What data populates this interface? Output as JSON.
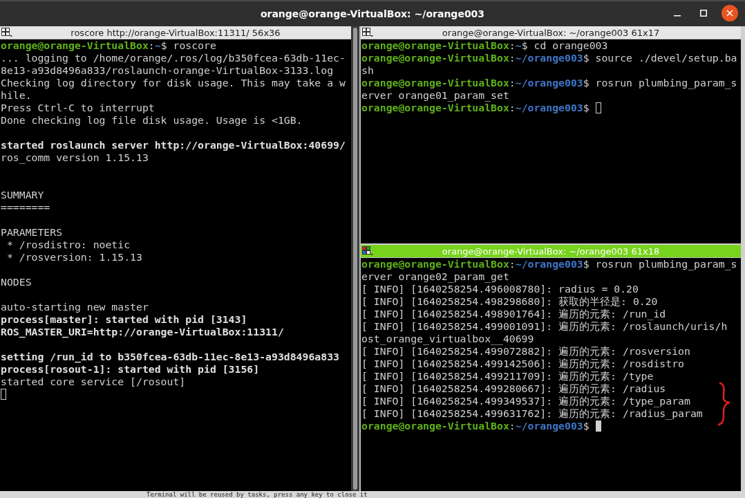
{
  "window": {
    "title": "orange@orange-VirtualBox: ~/orange003"
  },
  "left_pane": {
    "title": "roscore http://orange-VirtualBox:11311/ 56x36",
    "focused": false,
    "lines": [
      [
        {
          "kind": "user",
          "text": "orange@orange-VirtualBox"
        },
        {
          "kind": "plain",
          "text": ":"
        },
        {
          "kind": "path",
          "text": "~"
        },
        {
          "kind": "plain",
          "text": "$ roscore"
        }
      ],
      [
        {
          "kind": "plain",
          "text": "... logging to /home/orange/.ros/log/b350fcea-63db-11ec-"
        }
      ],
      [
        {
          "kind": "plain",
          "text": "8e13-a93d8496a833/roslaunch-orange-VirtualBox-3133.log"
        }
      ],
      [
        {
          "kind": "plain",
          "text": "Checking log directory for disk usage. This may take a w"
        }
      ],
      [
        {
          "kind": "plain",
          "text": "hile."
        }
      ],
      [
        {
          "kind": "plain",
          "text": "Press Ctrl-C to interrupt"
        }
      ],
      [
        {
          "kind": "plain",
          "text": "Done checking log file disk usage. Usage is <1GB."
        }
      ],
      [
        {
          "kind": "blank"
        }
      ],
      [
        {
          "kind": "bold",
          "text": "started roslaunch server http://orange-VirtualBox:40699/"
        }
      ],
      [
        {
          "kind": "plain",
          "text": "ros_comm version 1.15.13"
        }
      ],
      [
        {
          "kind": "blank"
        }
      ],
      [
        {
          "kind": "blank"
        }
      ],
      [
        {
          "kind": "plain",
          "text": "SUMMARY"
        }
      ],
      [
        {
          "kind": "plain",
          "text": "========"
        }
      ],
      [
        {
          "kind": "blank"
        }
      ],
      [
        {
          "kind": "plain",
          "text": "PARAMETERS"
        }
      ],
      [
        {
          "kind": "plain",
          "text": " * /rosdistro: noetic"
        }
      ],
      [
        {
          "kind": "plain",
          "text": " * /rosversion: 1.15.13"
        }
      ],
      [
        {
          "kind": "blank"
        }
      ],
      [
        {
          "kind": "plain",
          "text": "NODES"
        }
      ],
      [
        {
          "kind": "blank"
        }
      ],
      [
        {
          "kind": "plain",
          "text": "auto-starting new master"
        }
      ],
      [
        {
          "kind": "bold",
          "text": "process[master]: started with pid [3143]"
        }
      ],
      [
        {
          "kind": "bold",
          "text": "ROS_MASTER_URI=http://orange-VirtualBox:11311/"
        }
      ],
      [
        {
          "kind": "blank"
        }
      ],
      [
        {
          "kind": "bold",
          "text": "setting /run_id to b350fcea-63db-11ec-8e13-a93d8496a833"
        }
      ],
      [
        {
          "kind": "bold",
          "text": "process[rosout-1]: started with pid [3156]"
        }
      ],
      [
        {
          "kind": "plain",
          "text": "started core service [/rosout]"
        }
      ],
      [
        {
          "kind": "cursor"
        }
      ]
    ]
  },
  "right_panes": [
    {
      "title": "orange@orange-VirtualBox: ~/orange003 61x17",
      "focused": false,
      "lines": [
        [
          {
            "kind": "user",
            "text": "orange@orange-VirtualBox"
          },
          {
            "kind": "plain",
            "text": ":"
          },
          {
            "kind": "path",
            "text": "~"
          },
          {
            "kind": "plain",
            "text": "$ cd orange003"
          }
        ],
        [
          {
            "kind": "user",
            "text": "orange@orange-VirtualBox"
          },
          {
            "kind": "plain",
            "text": ":"
          },
          {
            "kind": "path",
            "text": "~/orange003"
          },
          {
            "kind": "plain",
            "text": "$ source ./devel/setup.ba"
          }
        ],
        [
          {
            "kind": "plain",
            "text": "sh"
          }
        ],
        [
          {
            "kind": "user",
            "text": "orange@orange-VirtualBox"
          },
          {
            "kind": "plain",
            "text": ":"
          },
          {
            "kind": "path",
            "text": "~/orange003"
          },
          {
            "kind": "plain",
            "text": "$ rosrun plumbing_param_s"
          }
        ],
        [
          {
            "kind": "plain",
            "text": "erver orange01_param_set"
          }
        ],
        [
          {
            "kind": "user",
            "text": "orange@orange-VirtualBox"
          },
          {
            "kind": "plain",
            "text": ":"
          },
          {
            "kind": "path",
            "text": "~/orange003"
          },
          {
            "kind": "plain",
            "text": "$ "
          },
          {
            "kind": "cursor"
          }
        ]
      ]
    },
    {
      "title": "orange@orange-VirtualBox: ~/orange003 61x18",
      "focused": true,
      "lines": [
        [
          {
            "kind": "user",
            "text": "orange@orange-VirtualBox"
          },
          {
            "kind": "plain",
            "text": ":"
          },
          {
            "kind": "path",
            "text": "~/orange003"
          },
          {
            "kind": "plain",
            "text": "$ rosrun plumbing_param_s"
          }
        ],
        [
          {
            "kind": "plain",
            "text": "erver orange02_param_get"
          }
        ],
        [
          {
            "kind": "plain",
            "text": "[ INFO] [1640258254.496008780]: radius = 0.20"
          }
        ],
        [
          {
            "kind": "plain",
            "text": "[ INFO] [1640258254.498298680]: 获取的半径是: 0.20"
          }
        ],
        [
          {
            "kind": "plain",
            "text": "[ INFO] [1640258254.498901764]: 遍历的元素: /run_id"
          }
        ],
        [
          {
            "kind": "plain",
            "text": "[ INFO] [1640258254.499001091]: 遍历的元素: /roslaunch/uris/h"
          }
        ],
        [
          {
            "kind": "plain",
            "text": "ost_orange_virtualbox__40699"
          }
        ],
        [
          {
            "kind": "plain",
            "text": "[ INFO] [1640258254.499072882]: 遍历的元素: /rosversion"
          }
        ],
        [
          {
            "kind": "plain",
            "text": "[ INFO] [1640258254.499142506]: 遍历的元素: /rosdistro"
          }
        ],
        [
          {
            "kind": "plain",
            "text": "[ INFO] [1640258254.499211709]: 遍历的元素: /type"
          }
        ],
        [
          {
            "kind": "plain",
            "text": "[ INFO] [1640258254.499280667]: 遍历的元素: /radius"
          }
        ],
        [
          {
            "kind": "plain",
            "text": "[ INFO] [1640258254.499349537]: 遍历的元素: /type_param"
          }
        ],
        [
          {
            "kind": "plain",
            "text": "[ INFO] [1640258254.499631762]: 遍历的元素: /radius_param"
          }
        ],
        [
          {
            "kind": "user",
            "text": "orange@orange-VirtualBox"
          },
          {
            "kind": "plain",
            "text": ":"
          },
          {
            "kind": "path",
            "text": "~/orange003"
          },
          {
            "kind": "plain",
            "text": "$ "
          },
          {
            "kind": "cursor"
          }
        ]
      ]
    }
  ],
  "background_window": {
    "text": "Terminal will be reused by tasks, press any key to close it"
  }
}
